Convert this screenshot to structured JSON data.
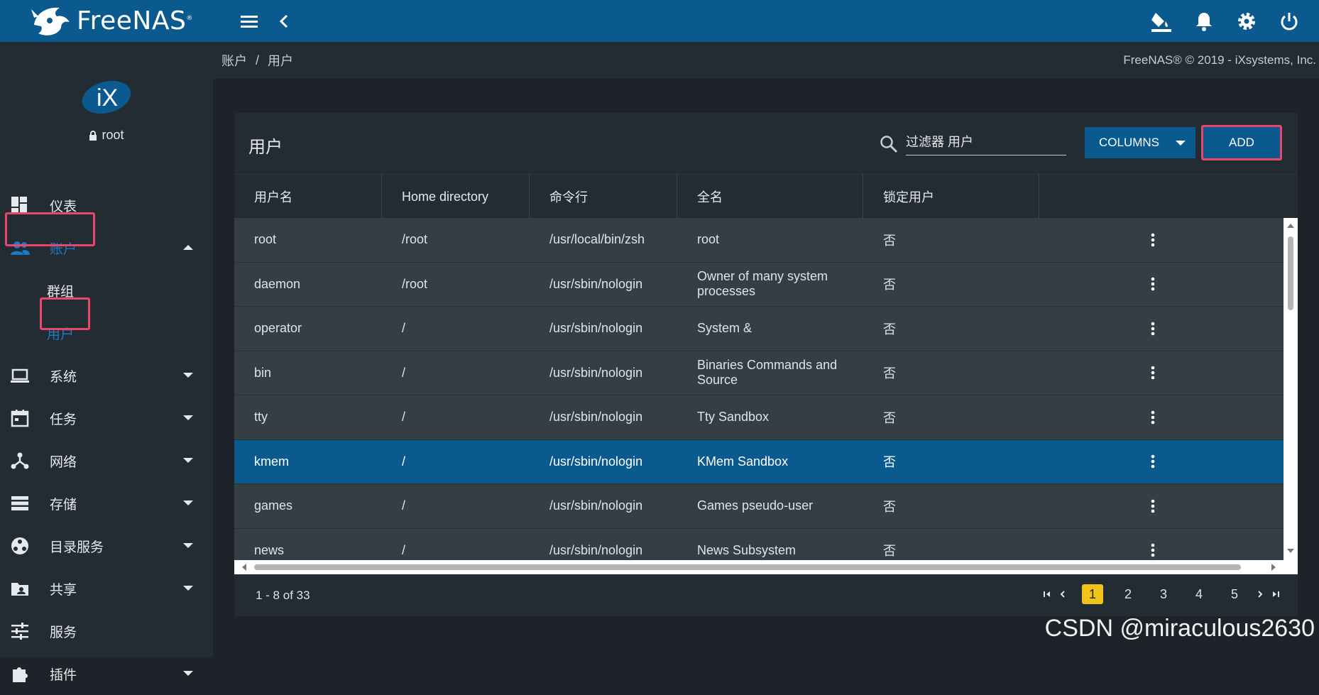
{
  "app": {
    "name": "FreeNAS",
    "brand_mark": "®"
  },
  "topbar": {
    "icons": [
      "menu-icon",
      "chevron-left-icon",
      "paint-bucket-icon",
      "bell-icon",
      "gear-icon",
      "power-icon"
    ]
  },
  "profile": {
    "username": "root"
  },
  "sidebar": {
    "items": [
      {
        "label": "仪表",
        "icon": "dashboard-icon"
      },
      {
        "label": "账户",
        "icon": "accounts-icon"
      },
      {
        "label": "系统",
        "icon": "laptop-icon"
      },
      {
        "label": "任务",
        "icon": "calendar-icon"
      },
      {
        "label": "网络",
        "icon": "network-icon"
      },
      {
        "label": "存储",
        "icon": "storage-icon"
      },
      {
        "label": "目录服务",
        "icon": "directory-icon"
      },
      {
        "label": "共享",
        "icon": "share-folder-icon"
      },
      {
        "label": "服务",
        "icon": "sliders-icon"
      },
      {
        "label": "插件",
        "icon": "puzzle-icon"
      }
    ],
    "sub_items": [
      {
        "label": "群组"
      },
      {
        "label": "用户"
      }
    ]
  },
  "breadcrumb": {
    "parent": "账户",
    "separator": "/",
    "current": "用户"
  },
  "copyright": "FreeNAS® © 2019 - iXsystems, Inc.",
  "card": {
    "title": "用户",
    "search_placeholder": "过滤器 用户",
    "columns_label": "COLUMNS",
    "add_label": "ADD"
  },
  "table": {
    "headers": [
      "用户名",
      "Home directory",
      "命令行",
      "全名",
      "锁定用户"
    ],
    "rows": [
      {
        "username": "root",
        "home": "/root",
        "shell": "/usr/local/bin/zsh",
        "fullname": "root",
        "locked": "否"
      },
      {
        "username": "daemon",
        "home": "/root",
        "shell": "/usr/sbin/nologin",
        "fullname": "Owner of many system processes",
        "locked": "否"
      },
      {
        "username": "operator",
        "home": "/",
        "shell": "/usr/sbin/nologin",
        "fullname": "System &",
        "locked": "否"
      },
      {
        "username": "bin",
        "home": "/",
        "shell": "/usr/sbin/nologin",
        "fullname": "Binaries Commands and Source",
        "locked": "否"
      },
      {
        "username": "tty",
        "home": "/",
        "shell": "/usr/sbin/nologin",
        "fullname": "Tty Sandbox",
        "locked": "否"
      },
      {
        "username": "kmem",
        "home": "/",
        "shell": "/usr/sbin/nologin",
        "fullname": "KMem Sandbox",
        "locked": "否"
      },
      {
        "username": "games",
        "home": "/",
        "shell": "/usr/sbin/nologin",
        "fullname": "Games pseudo-user",
        "locked": "否"
      },
      {
        "username": "news",
        "home": "/",
        "shell": "/usr/sbin/nologin",
        "fullname": "News Subsystem",
        "locked": "否"
      }
    ],
    "selected_row": 5
  },
  "pagination": {
    "range": "1 - 8 of 33",
    "pages": [
      "1",
      "2",
      "3",
      "4",
      "5"
    ],
    "current": "1"
  },
  "watermark": "CSDN @miraculous2630",
  "colors": {
    "topbar": "#0b5a8f",
    "sidebar": "#232b33",
    "background": "#1d2329",
    "active_nav": "#1b7bc4",
    "highlight_box": "#e8466a",
    "current_page": "#f0c419"
  }
}
